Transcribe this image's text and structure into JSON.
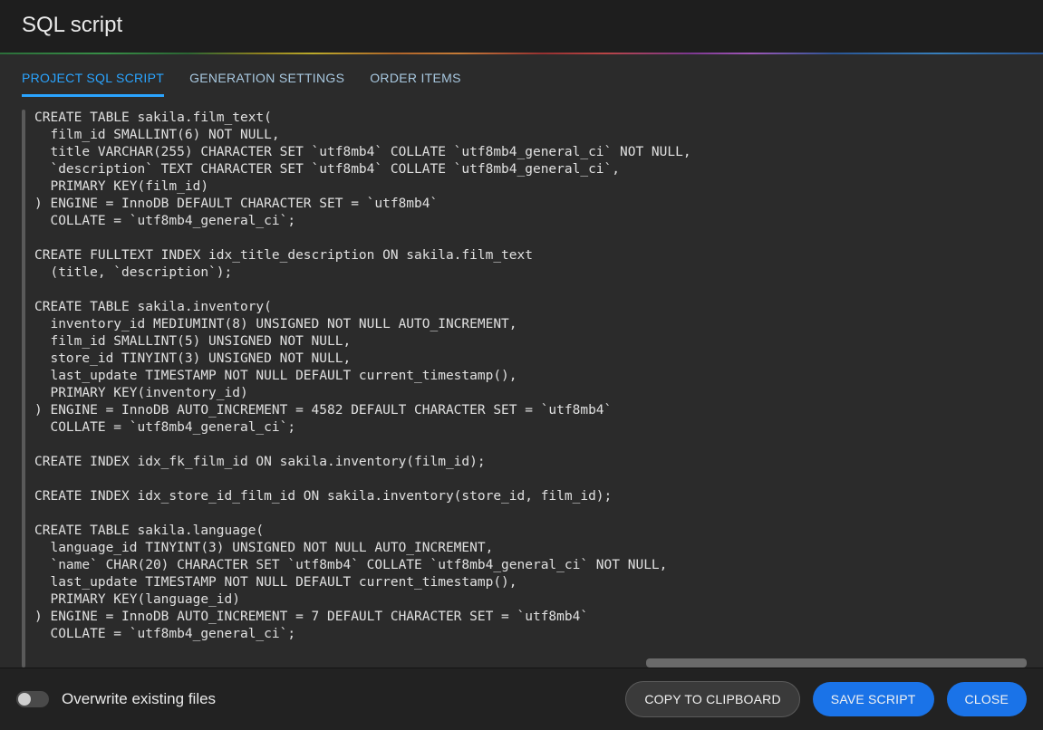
{
  "header": {
    "title": "SQL script"
  },
  "tabs": [
    {
      "id": "project",
      "label": "PROJECT SQL SCRIPT",
      "active": true
    },
    {
      "id": "gensettings",
      "label": "GENERATION SETTINGS",
      "active": false
    },
    {
      "id": "orderitems",
      "label": "ORDER ITEMS",
      "active": false
    }
  ],
  "code": "CREATE TABLE sakila.film_text(\n  film_id SMALLINT(6) NOT NULL,\n  title VARCHAR(255) CHARACTER SET `utf8mb4` COLLATE `utf8mb4_general_ci` NOT NULL,\n  `description` TEXT CHARACTER SET `utf8mb4` COLLATE `utf8mb4_general_ci`,\n  PRIMARY KEY(film_id)\n) ENGINE = InnoDB DEFAULT CHARACTER SET = `utf8mb4`\n  COLLATE = `utf8mb4_general_ci`;\n\nCREATE FULLTEXT INDEX idx_title_description ON sakila.film_text\n  (title, `description`);\n\nCREATE TABLE sakila.inventory(\n  inventory_id MEDIUMINT(8) UNSIGNED NOT NULL AUTO_INCREMENT,\n  film_id SMALLINT(5) UNSIGNED NOT NULL,\n  store_id TINYINT(3) UNSIGNED NOT NULL,\n  last_update TIMESTAMP NOT NULL DEFAULT current_timestamp(),\n  PRIMARY KEY(inventory_id)\n) ENGINE = InnoDB AUTO_INCREMENT = 4582 DEFAULT CHARACTER SET = `utf8mb4`\n  COLLATE = `utf8mb4_general_ci`;\n\nCREATE INDEX idx_fk_film_id ON sakila.inventory(film_id);\n\nCREATE INDEX idx_store_id_film_id ON sakila.inventory(store_id, film_id);\n\nCREATE TABLE sakila.language(\n  language_id TINYINT(3) UNSIGNED NOT NULL AUTO_INCREMENT,\n  `name` CHAR(20) CHARACTER SET `utf8mb4` COLLATE `utf8mb4_general_ci` NOT NULL,\n  last_update TIMESTAMP NOT NULL DEFAULT current_timestamp(),\n  PRIMARY KEY(language_id)\n) ENGINE = InnoDB AUTO_INCREMENT = 7 DEFAULT CHARACTER SET = `utf8mb4`\n  COLLATE = `utf8mb4_general_ci`;",
  "footer": {
    "overwrite_label": "Overwrite existing files",
    "overwrite_on": false,
    "copy_label": "COPY TO CLIPBOARD",
    "save_label": "SAVE SCRIPT",
    "close_label": "CLOSE"
  },
  "colors": {
    "tab_active": "#2aa4ff",
    "primary_button": "#1a73e8",
    "background": "#2b2b2b"
  }
}
